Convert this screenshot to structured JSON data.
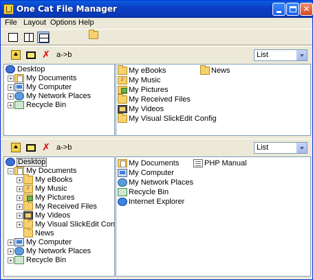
{
  "window": {
    "title": "One Cat File Manager"
  },
  "menu": [
    "File",
    "Layout",
    "Options",
    "Help"
  ],
  "layout_toolbar": {
    "icons": [
      "single-pane-icon",
      "vertical-split-icon",
      "horizontal-split-icon",
      "open-folder-icon"
    ],
    "selected": "horizontal-split-icon"
  },
  "top_pane": {
    "toolbar": {
      "swap_label": "a->b",
      "view_value": "List"
    },
    "tree": [
      {
        "label": "Desktop",
        "icon": "desktop-icon",
        "level": 0,
        "expander": "",
        "selected": false
      },
      {
        "label": "My Documents",
        "icon": "my-documents-icon",
        "level": 1,
        "expander": "+"
      },
      {
        "label": "My Computer",
        "icon": "computer-icon",
        "level": 1,
        "expander": "+"
      },
      {
        "label": "My Network Places",
        "icon": "network-icon",
        "level": 1,
        "expander": "+"
      },
      {
        "label": "Recycle Bin",
        "icon": "recycle-bin-icon",
        "level": 1,
        "expander": "+"
      }
    ],
    "list_col1": [
      {
        "label": "My eBooks",
        "icon": "folder-icon"
      },
      {
        "label": "My Music",
        "icon": "music-folder-icon"
      },
      {
        "label": "My Pictures",
        "icon": "pictures-folder-icon"
      },
      {
        "label": "My Received Files",
        "icon": "folder-icon"
      },
      {
        "label": "My Videos",
        "icon": "video-folder-icon"
      },
      {
        "label": "My Visual SlickEdit Config",
        "icon": "folder-icon"
      }
    ],
    "list_col2": [
      {
        "label": "News",
        "icon": "folder-icon"
      }
    ]
  },
  "bottom_pane": {
    "toolbar": {
      "swap_label": "a->b",
      "view_value": "List"
    },
    "tree": [
      {
        "label": "Desktop",
        "icon": "desktop-icon",
        "level": 0,
        "expander": "-",
        "selected": true
      },
      {
        "label": "My Documents",
        "icon": "my-documents-icon",
        "level": 1,
        "expander": "-"
      },
      {
        "label": "My eBooks",
        "icon": "folder-icon",
        "level": 2,
        "expander": "+"
      },
      {
        "label": "My Music",
        "icon": "music-folder-icon",
        "level": 2,
        "expander": "+"
      },
      {
        "label": "My Pictures",
        "icon": "pictures-folder-icon",
        "level": 2,
        "expander": "+"
      },
      {
        "label": "My Received Files",
        "icon": "folder-icon",
        "level": 2,
        "expander": "+"
      },
      {
        "label": "My Videos",
        "icon": "video-folder-icon",
        "level": 2,
        "expander": "+"
      },
      {
        "label": "My Visual SlickEdit Config",
        "icon": "folder-icon",
        "level": 2,
        "expander": "+"
      },
      {
        "label": "News",
        "icon": "folder-icon",
        "level": 2,
        "expander": ""
      },
      {
        "label": "My Computer",
        "icon": "computer-icon",
        "level": 1,
        "expander": "+"
      },
      {
        "label": "My Network Places",
        "icon": "network-icon",
        "level": 1,
        "expander": "+"
      },
      {
        "label": "Recycle Bin",
        "icon": "recycle-bin-icon",
        "level": 1,
        "expander": "+"
      }
    ],
    "list_col1": [
      {
        "label": "My Documents",
        "icon": "my-documents-icon"
      },
      {
        "label": "My Computer",
        "icon": "computer-icon"
      },
      {
        "label": "My Network Places",
        "icon": "network-icon"
      },
      {
        "label": "Recycle Bin",
        "icon": "recycle-bin-icon"
      },
      {
        "label": "Internet Explorer",
        "icon": "internet-explorer-icon"
      }
    ],
    "list_col2": [
      {
        "label": "PHP Manual",
        "icon": "php-manual-icon"
      }
    ]
  }
}
